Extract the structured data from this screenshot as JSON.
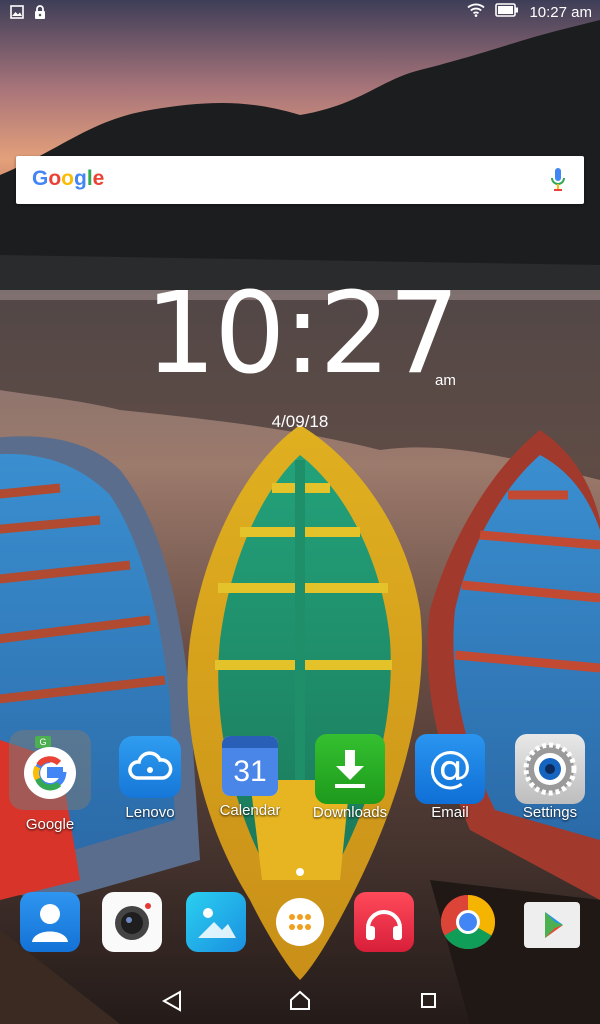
{
  "status_bar": {
    "left_icons": [
      "image-notification-icon",
      "lock-icon"
    ],
    "right_icons": [
      "wifi-icon",
      "battery-icon"
    ],
    "time": "10:27 am"
  },
  "search": {
    "logo": "Google",
    "mic_icon": "mic-icon"
  },
  "clock": {
    "time": "10:27",
    "ampm": "am",
    "date": "4/09/18"
  },
  "home_apps": [
    {
      "label": "Google",
      "icon": "google-folder-icon"
    },
    {
      "label": "Lenovo",
      "icon": "lenovo-cloud-icon"
    },
    {
      "label": "Calendar",
      "icon": "calendar-icon",
      "badge": "31"
    },
    {
      "label": "Downloads",
      "icon": "downloads-icon"
    },
    {
      "label": "Email",
      "icon": "email-icon",
      "glyph": "@"
    },
    {
      "label": "Settings",
      "icon": "settings-icon"
    }
  ],
  "dock_apps": [
    {
      "icon": "contacts-icon"
    },
    {
      "icon": "camera-icon"
    },
    {
      "icon": "gallery-icon"
    },
    {
      "icon": "app-drawer-icon"
    },
    {
      "icon": "music-icon"
    },
    {
      "icon": "chrome-icon"
    },
    {
      "icon": "play-store-icon"
    }
  ],
  "nav_bar": [
    "back-icon",
    "home-icon",
    "recents-icon"
  ],
  "colors": {
    "downloads": "#2fb52a",
    "email": "#1e86e8",
    "lenovo": "#1f8fe6",
    "calendar": "#3b78e7"
  }
}
